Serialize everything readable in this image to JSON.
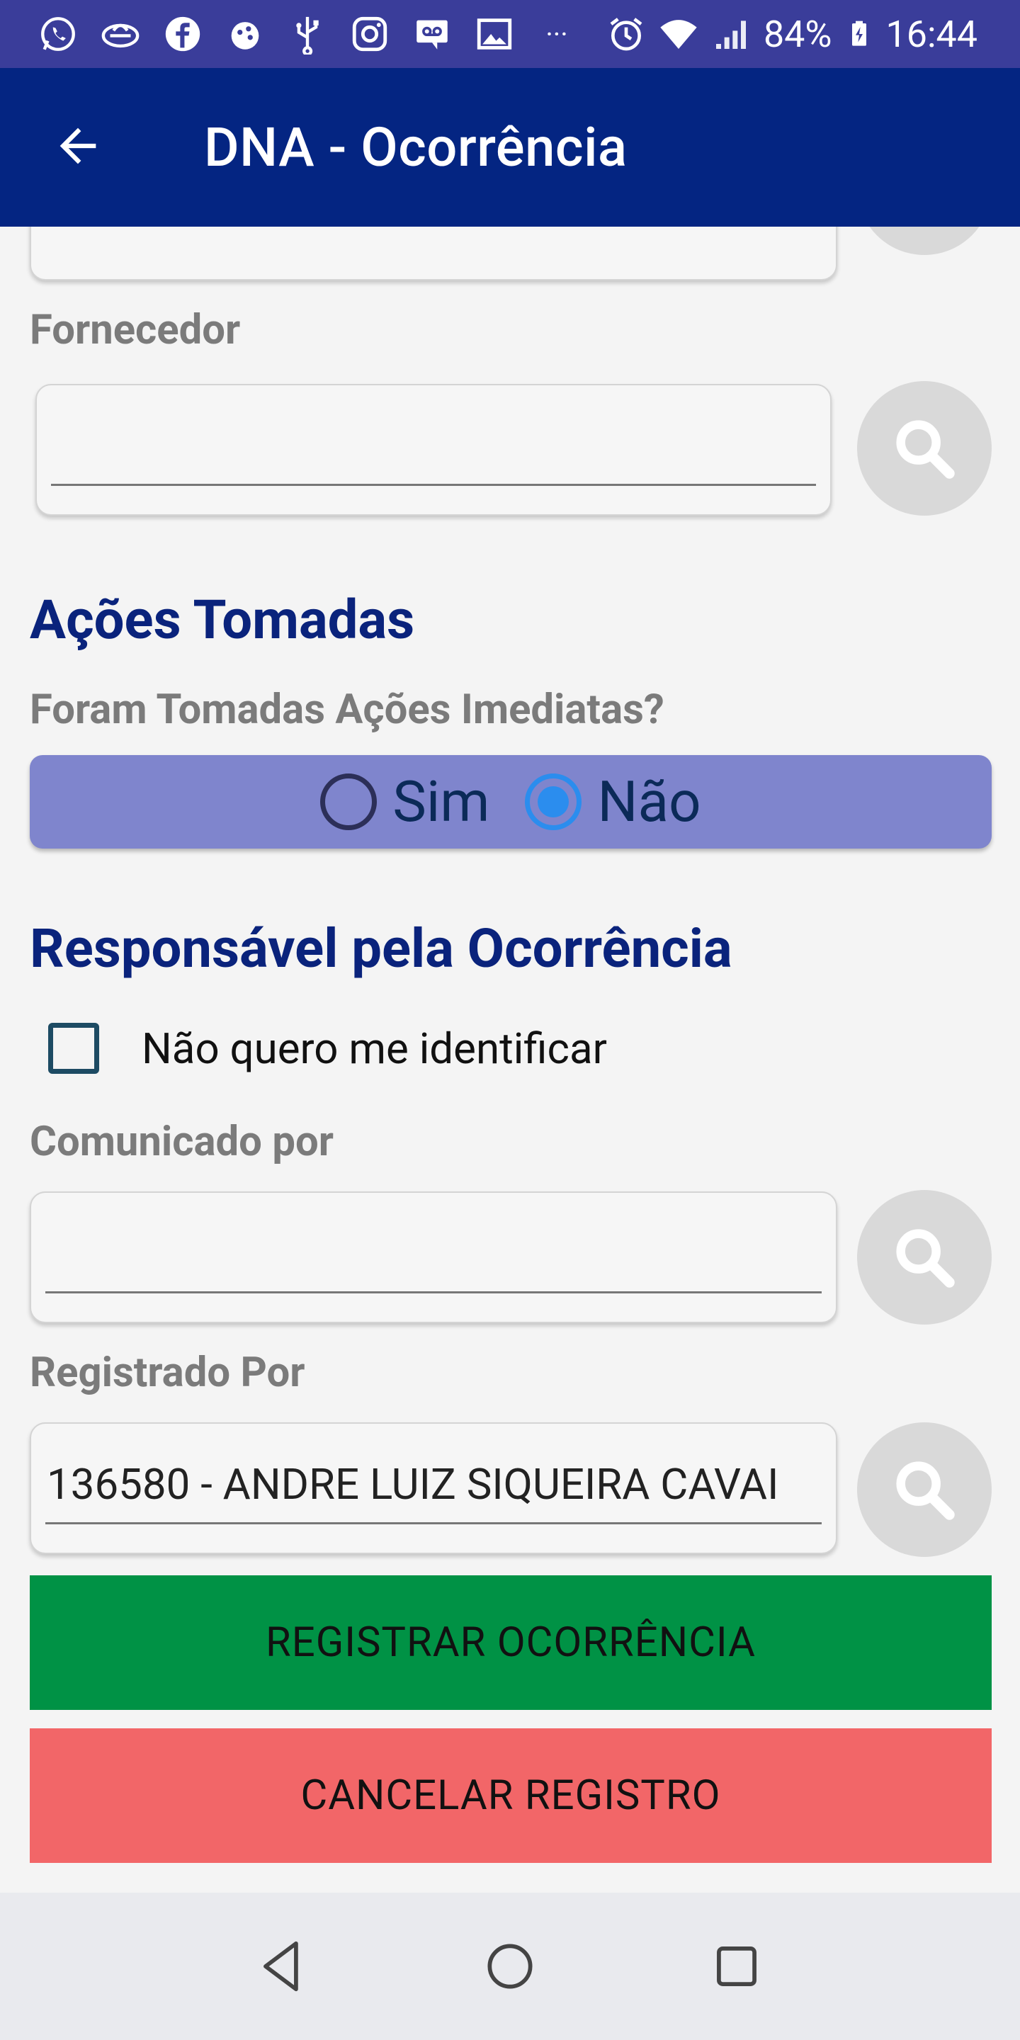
{
  "status_bar": {
    "left_icons": [
      "whatsapp-icon",
      "tab-icon",
      "facebook-icon",
      "app-icon",
      "usb-icon",
      "instagram-icon",
      "voicemail-icon",
      "image-icon",
      "more-icon"
    ],
    "more": "···",
    "battery": "84%",
    "time": "16:44"
  },
  "app_bar": {
    "title": "DNA - Ocorrência"
  },
  "form": {
    "fornecedor": {
      "label": "Fornecedor",
      "value": ""
    },
    "acoes": {
      "title": "Ações Tomadas",
      "question": "Foram Tomadas Ações Imediatas?",
      "options": [
        "Sim",
        "Não"
      ],
      "selected": "Não"
    },
    "responsavel": {
      "title": "Responsável pela Ocorrência",
      "anon_label": "Não quero me identificar",
      "anon_checked": false
    },
    "comunicado": {
      "label": "Comunicado por",
      "value": ""
    },
    "registrado": {
      "label": "Registrado Por",
      "value": "136580 - ANDRE LUIZ SIQUEIRA CAVAI"
    }
  },
  "actions": {
    "register": "REGISTRAR OCORRÊNCIA",
    "cancel": "CANCELAR REGISTRO"
  },
  "colors": {
    "status_bar": "#3a3d9a",
    "app_bar": "#042582",
    "section_title": "#0a237c",
    "radio_group": "#7f85cd",
    "radio_selected": "#2b8dee",
    "register_button": "#009245",
    "cancel_button": "#f26668"
  }
}
